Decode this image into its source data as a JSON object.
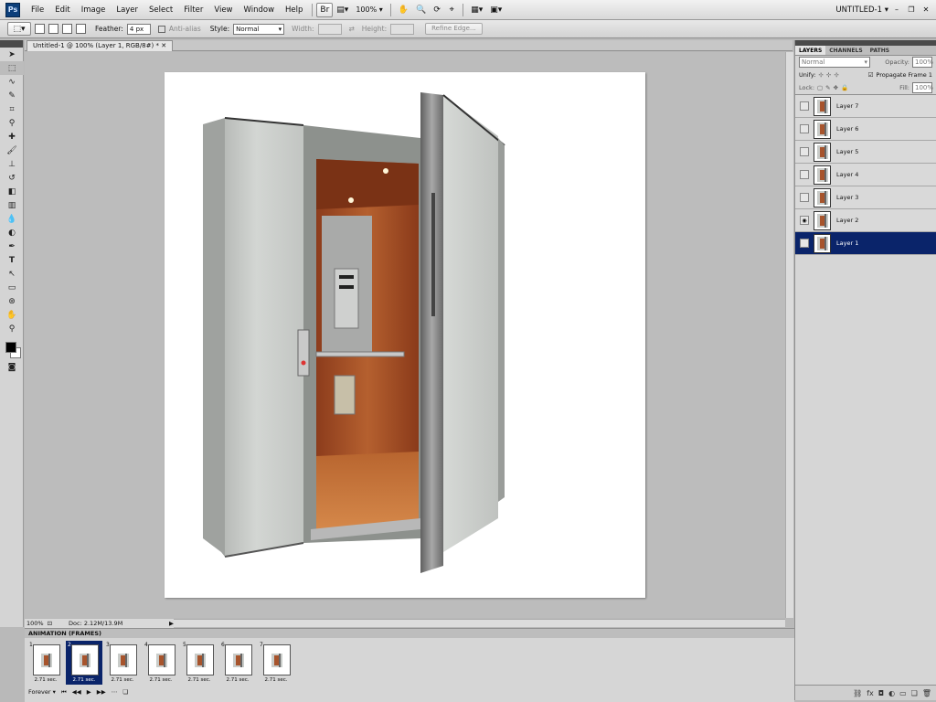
{
  "app": {
    "logo": "Ps",
    "workspace": "UNTITLED-1 ▾"
  },
  "menu": [
    "File",
    "Edit",
    "Image",
    "Layer",
    "Select",
    "Filter",
    "View",
    "Window",
    "Help"
  ],
  "appbar": {
    "bridge": "Br",
    "zoom": "100%"
  },
  "options": {
    "feather_label": "Feather:",
    "feather_value": "4 px",
    "antialias_label": "Anti-alias",
    "style_label": "Style:",
    "style_value": "Normal",
    "width_label": "Width:",
    "height_label": "Height:",
    "refine_label": "Refine Edge..."
  },
  "document": {
    "tab_title": "Untitled-1 @ 100% (Layer 1, RGB/8#) *",
    "zoom": "100%",
    "doc_size": "Doc: 2.12M/13.9M"
  },
  "layers_panel": {
    "tabs": [
      "LAYERS",
      "CHANNELS",
      "PATHS"
    ],
    "blend_mode": "Normal",
    "opacity_label": "Opacity:",
    "opacity_value": "100%",
    "unify_label": "Unify:",
    "propagate_label": "Propagate Frame 1",
    "lock_label": "Lock:",
    "fill_label": "Fill:",
    "fill_value": "100%",
    "layers": [
      {
        "name": "Layer 7",
        "visible": false
      },
      {
        "name": "Layer 6",
        "visible": false
      },
      {
        "name": "Layer 5",
        "visible": false
      },
      {
        "name": "Layer 4",
        "visible": false
      },
      {
        "name": "Layer 3",
        "visible": false
      },
      {
        "name": "Layer 2",
        "visible": true
      },
      {
        "name": "Layer 1",
        "visible": false,
        "selected": true
      }
    ]
  },
  "animation": {
    "title": "ANIMATION (FRAMES)",
    "frames": [
      {
        "num": "1",
        "delay": "2.71 sec."
      },
      {
        "num": "2",
        "delay": "2.71 sec.",
        "selected": true
      },
      {
        "num": "3",
        "delay": "2.71 sec."
      },
      {
        "num": "4",
        "delay": "2.71 sec."
      },
      {
        "num": "5",
        "delay": "2.71 sec."
      },
      {
        "num": "6",
        "delay": "2.71 sec."
      },
      {
        "num": "7",
        "delay": "2.71 sec."
      }
    ],
    "loop": "Forever"
  },
  "colors": {
    "selection": "#0a246a",
    "interior": "#a7542c",
    "cabin": "#c9ccc9"
  }
}
